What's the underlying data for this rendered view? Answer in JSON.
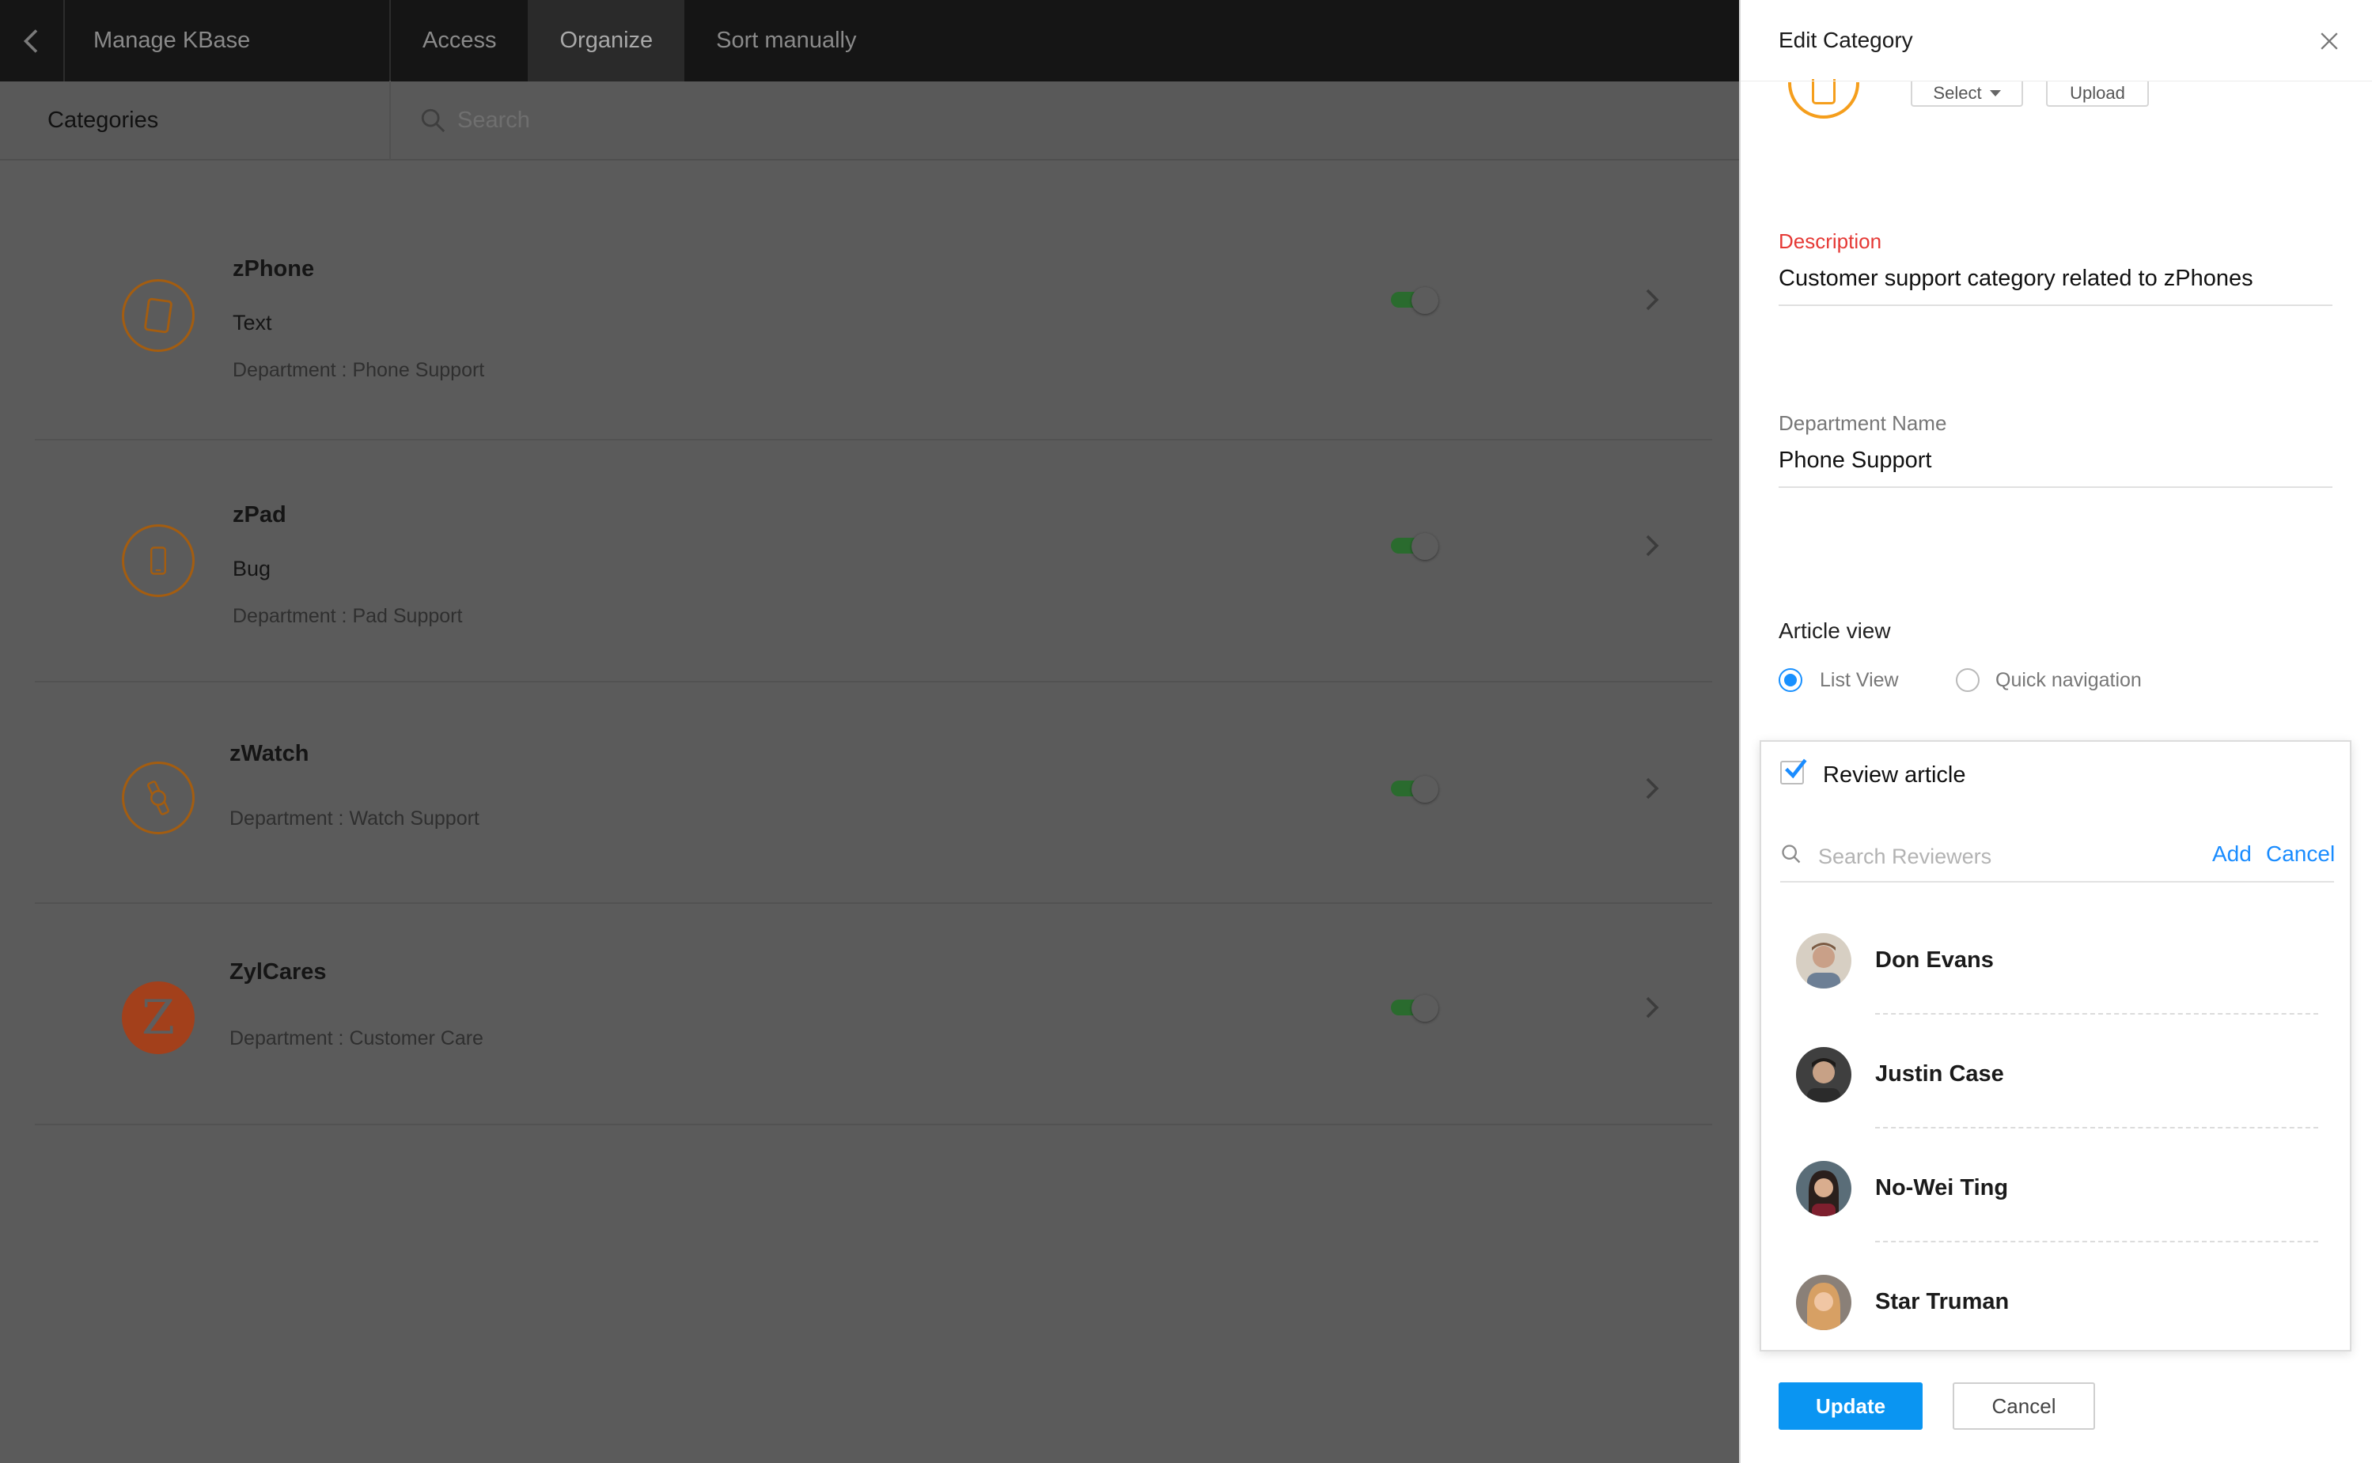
{
  "topbar": {
    "title": "Manage KBase",
    "tabs": [
      {
        "label": "Access",
        "active": false
      },
      {
        "label": "Organize",
        "active": true
      },
      {
        "label": "Sort manually",
        "active": false
      }
    ]
  },
  "subbar": {
    "section_label": "Categories",
    "search_placeholder": "Search"
  },
  "categories": [
    {
      "name": "zPhone",
      "type": "Text",
      "department": "Department : Phone Support",
      "icon": "tablet-icon",
      "enabled": true
    },
    {
      "name": "zPad",
      "type": "Bug",
      "department": "Department : Pad Support",
      "icon": "phone-icon",
      "enabled": true
    },
    {
      "name": "zWatch",
      "type": "",
      "department": "Department : Watch Support",
      "icon": "watch-icon",
      "enabled": true
    },
    {
      "name": "ZylCares",
      "type": "",
      "department": "Department : Customer Care",
      "icon": "z-logo-icon",
      "icon_letter": "Z",
      "enabled": true
    }
  ],
  "panel": {
    "title": "Edit Category",
    "logo_buttons": {
      "select": "Select",
      "upload": "Upload"
    },
    "description": {
      "label": "Description",
      "value": "Customer support category related to zPhones"
    },
    "department": {
      "label": "Department Name",
      "value": "Phone Support"
    },
    "article_view": {
      "label": "Article view",
      "options": [
        {
          "label": "List View",
          "selected": true
        },
        {
          "label": "Quick navigation",
          "selected": false
        }
      ]
    },
    "review": {
      "label": "Review article",
      "checked": true,
      "search_placeholder": "Search Reviewers",
      "add_label": "Add",
      "cancel_label": "Cancel",
      "reviewers": [
        {
          "name": "Don Evans",
          "tone": "#b98b6e"
        },
        {
          "name": "Justin Case",
          "tone": "#3b3734"
        },
        {
          "name": "No-Wei Ting",
          "tone": "#4a3a35"
        },
        {
          "name": "Star Truman",
          "tone": "#caa07a"
        }
      ]
    },
    "footer": {
      "update": "Update",
      "cancel": "Cancel"
    }
  },
  "colors": {
    "accent_blue": "#0a95f2",
    "link_blue": "#1a8cff",
    "orange": "#f59e1c",
    "description_label_red": "#e53935",
    "toggle_green": "#2a6b2e"
  }
}
